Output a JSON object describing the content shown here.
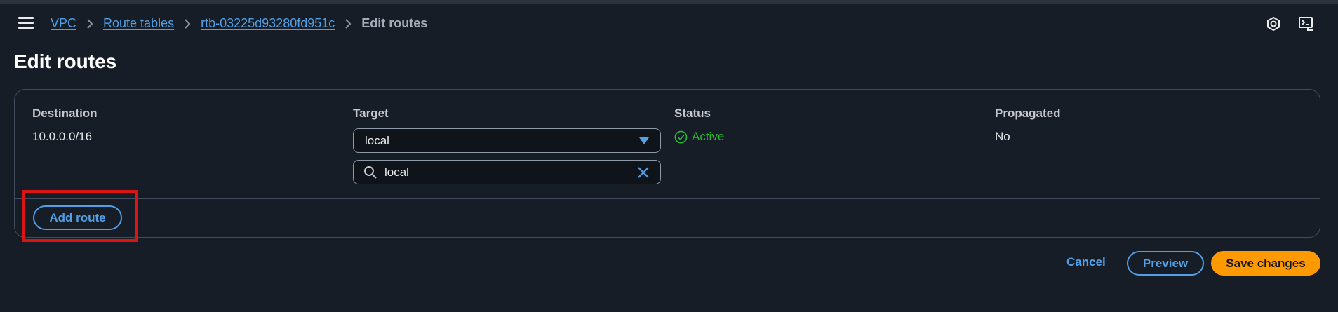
{
  "breadcrumb": {
    "items": [
      "VPC",
      "Route tables",
      "rtb-03225d93280fd951c"
    ],
    "current": "Edit routes"
  },
  "page": {
    "title": "Edit routes"
  },
  "routes_table": {
    "headers": [
      "Destination",
      "Target",
      "Status",
      "Propagated"
    ],
    "rows": [
      {
        "destination": "10.0.0.0/16",
        "target": "local",
        "target_filter": "local",
        "status": "Active",
        "propagated": "No"
      }
    ]
  },
  "actions": {
    "add_route": "Add route",
    "cancel": "Cancel",
    "preview": "Preview",
    "save": "Save changes"
  },
  "colors": {
    "background": "#161d26",
    "link": "#539fe5",
    "primary": "#ff9900",
    "success": "#2bb534",
    "highlight": "#d91515"
  },
  "icons": [
    "menu-icon",
    "chevron-right-icon",
    "hexagon-settings-icon",
    "cloudshell-icon",
    "caret-down-icon",
    "search-icon",
    "clear-icon",
    "check-circle-icon"
  ]
}
